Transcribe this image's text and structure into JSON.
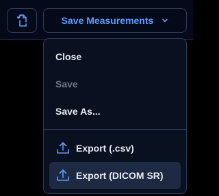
{
  "toolbar": {
    "icon_button": {
      "icon": "rotate-document-icon"
    },
    "save_button": {
      "label": "Save Measurements",
      "icon": "chevron-down-icon"
    }
  },
  "menu": {
    "items": [
      {
        "label": "Close",
        "enabled": true
      },
      {
        "label": "Save",
        "enabled": false
      },
      {
        "label": "Save As...",
        "enabled": true
      },
      {
        "label": "Export (.csv)",
        "enabled": true,
        "icon": "upload-icon"
      },
      {
        "label": "Export (DICOM SR)",
        "enabled": true,
        "icon": "upload-icon",
        "highlighted": true
      }
    ]
  },
  "colors": {
    "accent": "#5c9dff",
    "background": "#000000",
    "menu_background": "#09101f",
    "border": "#2c3d59",
    "highlight": "#1d2a42",
    "text": "#e6ebf2",
    "text_disabled": "#6b7586"
  }
}
